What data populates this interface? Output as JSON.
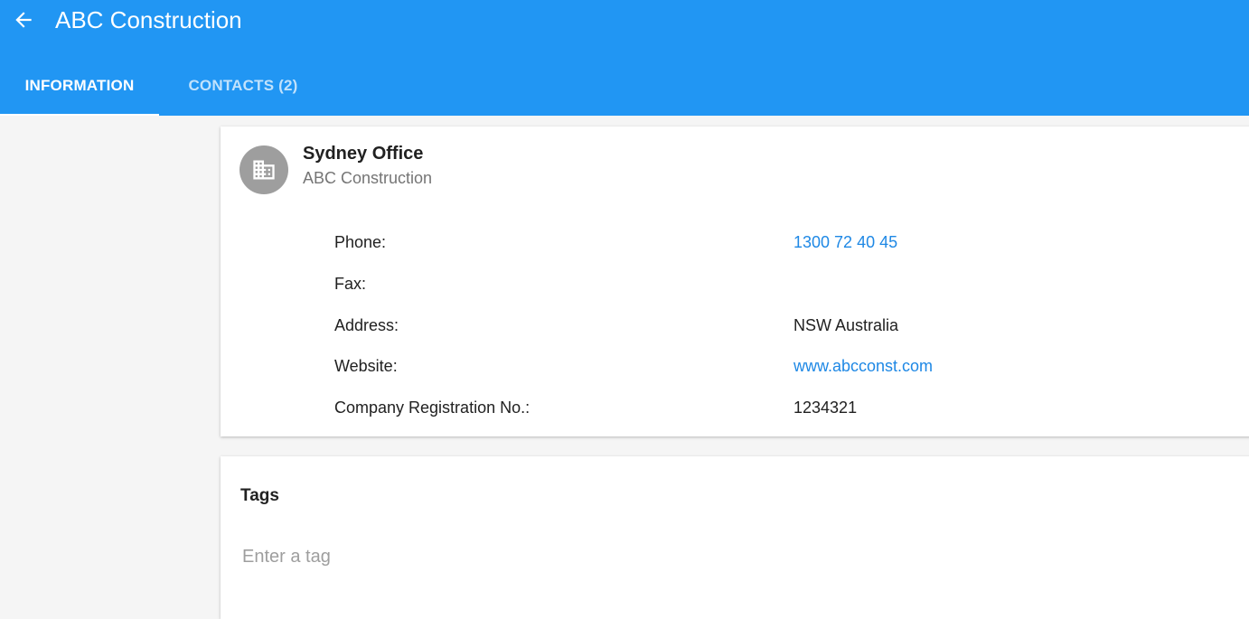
{
  "header": {
    "title": "ABC Construction",
    "back_icon": "arrow-left-icon",
    "background_color": "#2196f3"
  },
  "tabs": [
    {
      "label": "INFORMATION",
      "active": true
    },
    {
      "label": "CONTACTS (2)",
      "active": false
    }
  ],
  "office": {
    "icon": "building-icon",
    "name": "Sydney Office",
    "company": "ABC Construction",
    "details": [
      {
        "label": "Phone:",
        "value": "1300 72 40 45",
        "is_link": true
      },
      {
        "label": "Fax:",
        "value": "",
        "is_link": false
      },
      {
        "label": "Address:",
        "value": "NSW Australia",
        "is_link": false
      },
      {
        "label": "Website:",
        "value": "www.abcconst.com",
        "is_link": true
      },
      {
        "label": "Company Registration No.:",
        "value": "1234321",
        "is_link": false
      }
    ]
  },
  "tags": {
    "title": "Tags",
    "placeholder": "Enter a tag"
  },
  "colors": {
    "link": "#1e88e5",
    "avatar": "#9e9e9e"
  }
}
